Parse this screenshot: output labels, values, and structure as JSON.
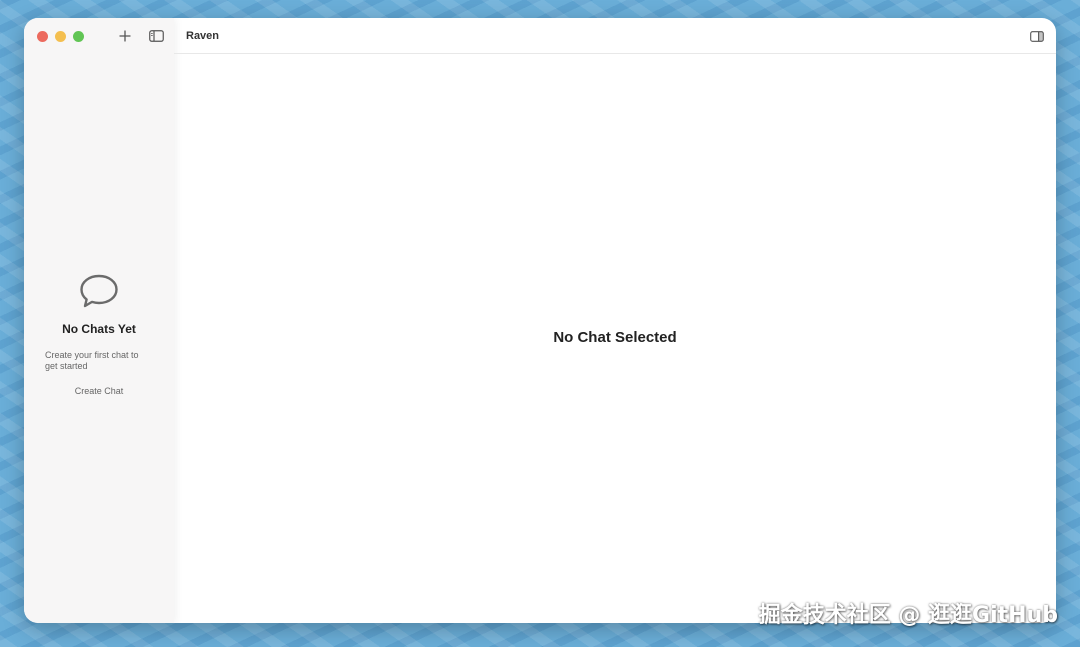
{
  "sidebar": {
    "empty_state": {
      "title": "No Chats Yet",
      "description": "Create your first chat to get started",
      "action_label": "Create Chat"
    },
    "icons": {
      "new": "plus-icon",
      "toggle": "sidebar-toggle-icon",
      "empty": "chat-bubble-icon"
    }
  },
  "header": {
    "title": "Raven"
  },
  "main": {
    "empty_message": "No Chat Selected"
  },
  "watermark": {
    "text": "掘金技术社区 @ 逛逛GitHub"
  },
  "colors": {
    "desktop_bg": "#6aaed8",
    "traffic_red": "#ec6a5e",
    "traffic_yellow": "#f4bf4f",
    "traffic_green": "#61c554"
  }
}
